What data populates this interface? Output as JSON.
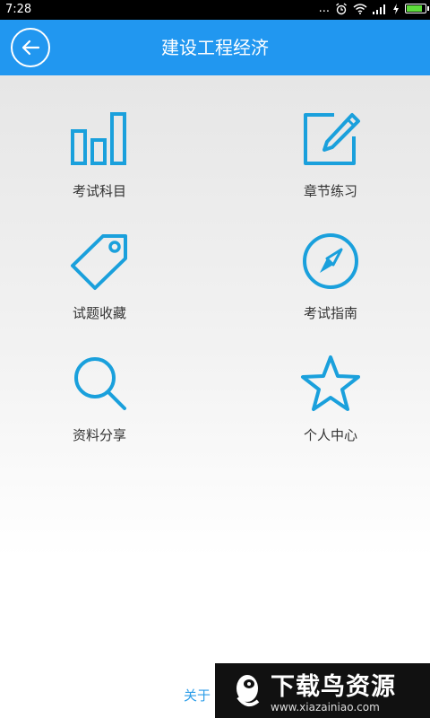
{
  "status_bar": {
    "time": "7:28",
    "dots": "..."
  },
  "header": {
    "title": "建设工程经济",
    "back_icon": "arrow-left-circle-icon"
  },
  "menu": {
    "accent": "#1aa0dc",
    "items": [
      {
        "label": "考试科目",
        "icon": "bar-chart-icon"
      },
      {
        "label": "章节练习",
        "icon": "edit-pencil-icon"
      },
      {
        "label": "试题收藏",
        "icon": "tag-icon"
      },
      {
        "label": "考试指南",
        "icon": "compass-icon"
      },
      {
        "label": "资料分享",
        "icon": "search-icon"
      },
      {
        "label": "个人中心",
        "icon": "star-icon"
      }
    ]
  },
  "footer": {
    "about": "关于"
  },
  "watermark": {
    "brand": "下载鸟资源",
    "url": "www.xiazainiao.com"
  },
  "colors": {
    "header_bg": "#2197f0",
    "link": "#2c9de8"
  }
}
